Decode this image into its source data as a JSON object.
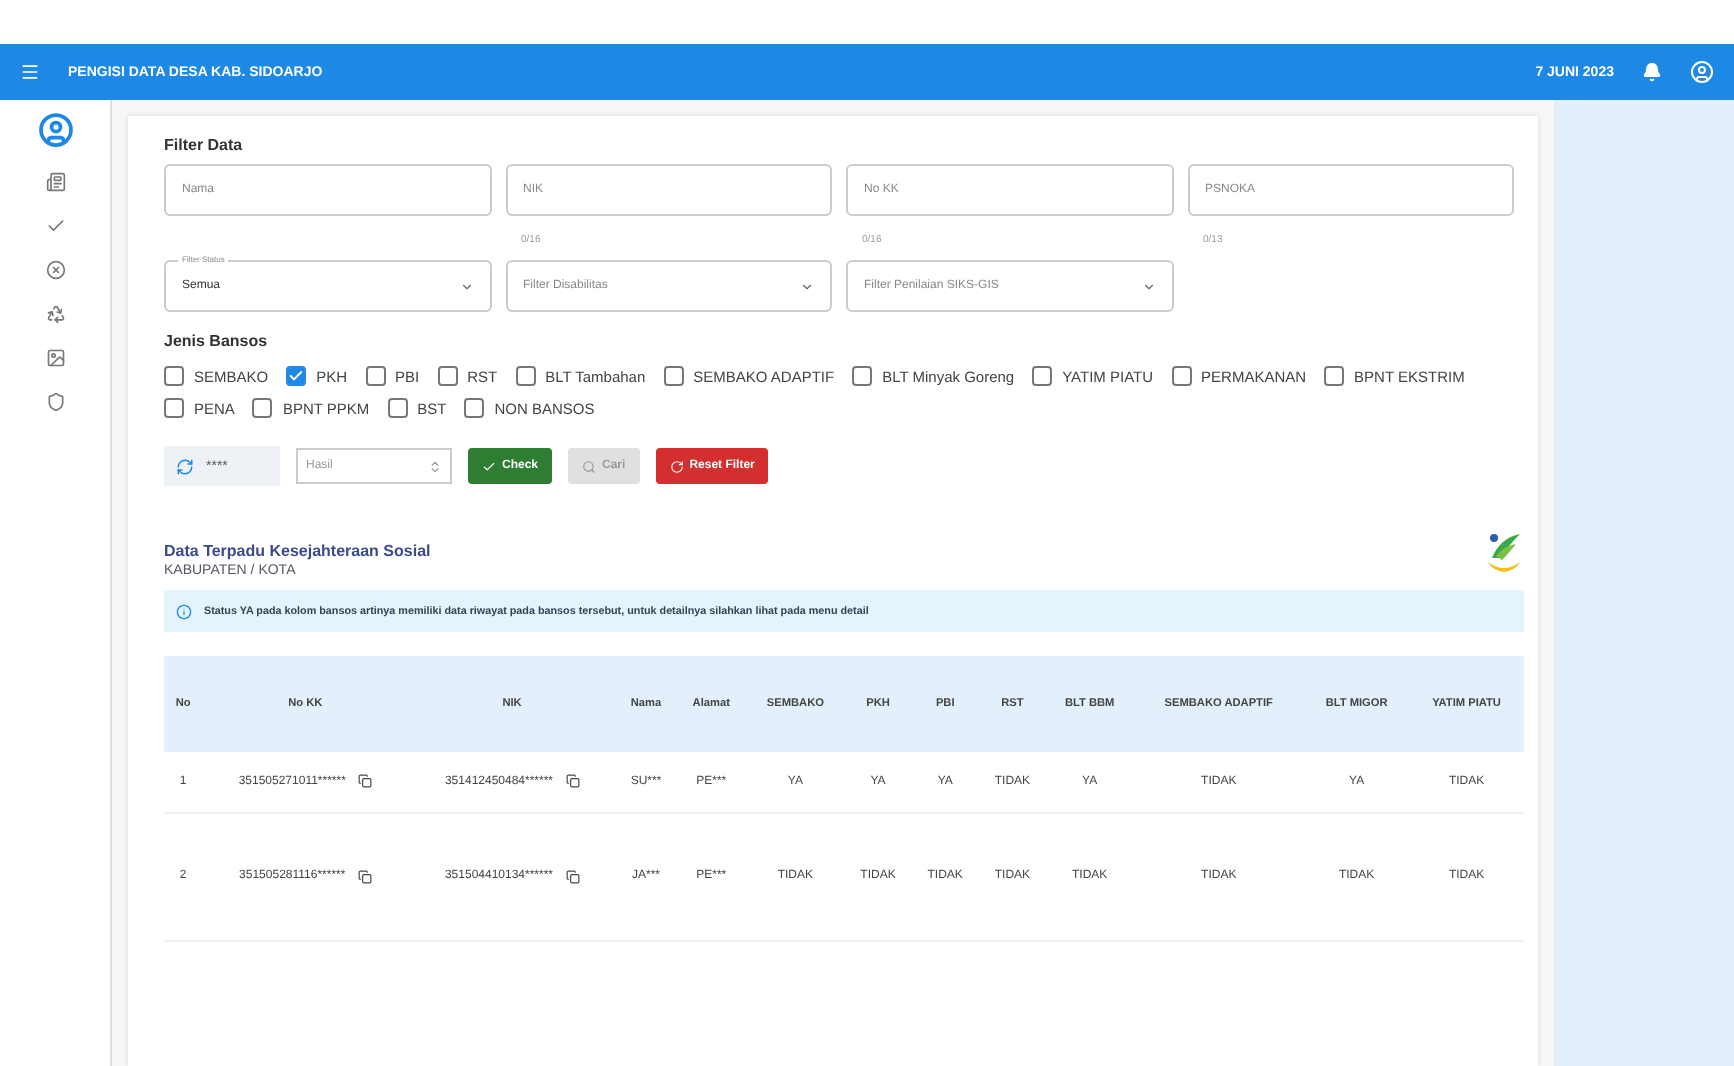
{
  "app_bar": {
    "title": "PENGISI DATA DESA KAB. SIDOARJO",
    "date": "7 JUNI 2023"
  },
  "filter": {
    "title": "Filter Data",
    "inputs": [
      {
        "placeholder": "Nama"
      },
      {
        "placeholder": "NIK",
        "counter": "0/16"
      },
      {
        "placeholder": "No KK",
        "counter": "0/16"
      },
      {
        "placeholder": "PSNOKA",
        "counter": "0/13"
      }
    ],
    "selects": [
      {
        "label": "Filter Status",
        "value": "Semua"
      },
      {
        "placeholder": "Filter Disabilitas"
      },
      {
        "placeholder": "Filter Penilaian SIKS-GIS"
      }
    ],
    "bansos_title": "Jenis Bansos",
    "bansos": [
      {
        "label": "SEMBAKO",
        "checked": false
      },
      {
        "label": "PKH",
        "checked": true
      },
      {
        "label": "PBI",
        "checked": false
      },
      {
        "label": "RST",
        "checked": false
      },
      {
        "label": "BLT Tambahan",
        "checked": false
      },
      {
        "label": "SEMBAKO ADAPTIF",
        "checked": false
      },
      {
        "label": "BLT Minyak Goreng",
        "checked": false
      },
      {
        "label": "YATIM PIATU",
        "checked": false
      },
      {
        "label": "PERMAKANAN",
        "checked": false
      },
      {
        "label": "BPNT EKSTRIM",
        "checked": false
      },
      {
        "label": "PENA",
        "checked": false
      },
      {
        "label": "BPNT PPKM",
        "checked": false
      },
      {
        "label": "BST",
        "checked": false
      },
      {
        "label": "NON BANSOS",
        "checked": false
      }
    ],
    "captcha": "****",
    "answer_placeholder": "Hasil",
    "check": "Check",
    "search": {
      "label": "Cari",
      "disabled": true
    },
    "reset": "Reset Filter"
  },
  "data": {
    "title": "Data Terpadu Kesejahteraan Sosial",
    "subtitle": "KABUPATEN / KOTA",
    "info": "Status YA pada kolom bansos artinya memiliki data riwayat pada bansos tersebut, untuk detailnya silahkan lihat pada menu detail",
    "columns": [
      "No",
      "No KK",
      "NIK",
      "Nama",
      "Alamat",
      "SEMBAKO",
      "PKH",
      "PBI",
      "RST",
      "BLT BBM",
      "SEMBAKO ADAPTIF",
      "BLT MIGOR",
      "YATIM PIATU"
    ],
    "rows": [
      [
        "1",
        "351505271011******",
        "351412450484******",
        "SU***",
        "PE***",
        "YA",
        "YA",
        "YA",
        "TIDAK",
        "YA",
        "TIDAK",
        "YA",
        "TIDAK"
      ],
      [
        "2",
        "351505281116******",
        "351504410134******",
        "JA***",
        "PE***",
        "TIDAK",
        "TIDAK",
        "TIDAK",
        "TIDAK",
        "TIDAK",
        "TIDAK",
        "TIDAK",
        "TIDAK"
      ]
    ]
  }
}
